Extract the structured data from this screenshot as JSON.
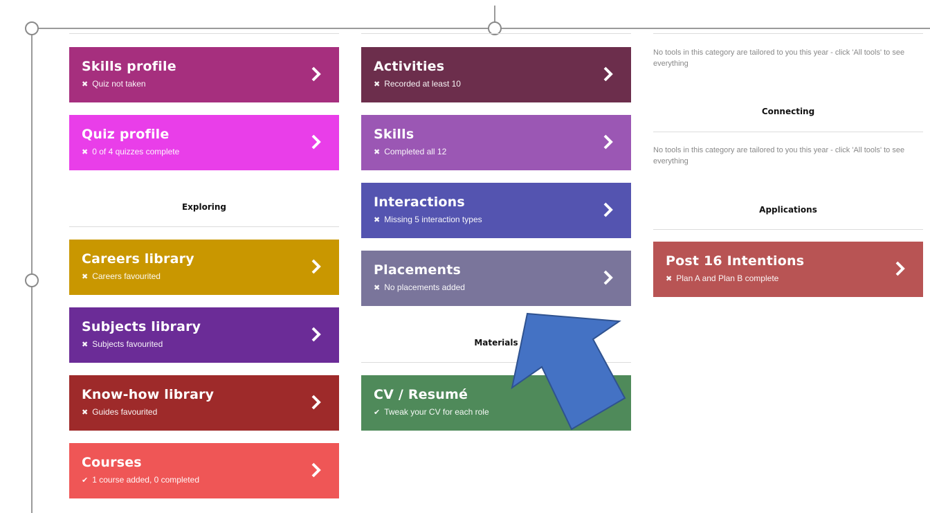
{
  "colors": {
    "skills_profile": "#a62f7e",
    "quiz_profile": "#e93ee9",
    "careers_library": "#c99700",
    "subjects_library": "#6b2c97",
    "knowhow_library": "#9e2a2a",
    "courses": "#ef5656",
    "activities": "#6c2e4c",
    "skills": "#9b57b4",
    "interactions": "#5454b0",
    "placements": "#7a759b",
    "cv_resume": "#4f8a5a",
    "post16": "#b85454",
    "arrow": "#4472c4"
  },
  "left": {
    "skills_profile": {
      "title": "Skills profile",
      "mark": "✖",
      "sub": "Quiz not taken"
    },
    "quiz_profile": {
      "title": "Quiz profile",
      "mark": "✖",
      "sub": "0 of 4 quizzes complete"
    },
    "exploring_heading": "Exploring",
    "careers_library": {
      "title": "Careers library",
      "mark": "✖",
      "sub": "Careers favourited"
    },
    "subjects_library": {
      "title": "Subjects library",
      "mark": "✖",
      "sub": "Subjects favourited"
    },
    "knowhow_library": {
      "title": "Know-how library",
      "mark": "✖",
      "sub": "Guides favourited"
    },
    "courses": {
      "title": "Courses",
      "mark": "✔",
      "sub": "1 course added, 0 completed"
    }
  },
  "middle": {
    "activities": {
      "title": "Activities",
      "mark": "✖",
      "sub": "Recorded at least 10"
    },
    "skills": {
      "title": "Skills",
      "mark": "✖",
      "sub": "Completed all 12"
    },
    "interactions": {
      "title": "Interactions",
      "mark": "✖",
      "sub": "Missing 5 interaction types"
    },
    "placements": {
      "title": "Placements",
      "mark": "✖",
      "sub": "No placements added"
    },
    "materials_heading": "Materials",
    "cv_resume": {
      "title": "CV / Resumé",
      "mark": "✔",
      "sub": "Tweak your CV for each role"
    }
  },
  "right": {
    "note_1": "No tools in this category are tailored to you this year - click 'All tools' to see everything",
    "connecting_heading": "Connecting",
    "note_2": "No tools in this category are tailored to you this year - click 'All tools' to see everything",
    "applications_heading": "Applications",
    "post16": {
      "title": "Post 16 Intentions",
      "mark": "✖",
      "sub": "Plan A and Plan B complete"
    }
  }
}
